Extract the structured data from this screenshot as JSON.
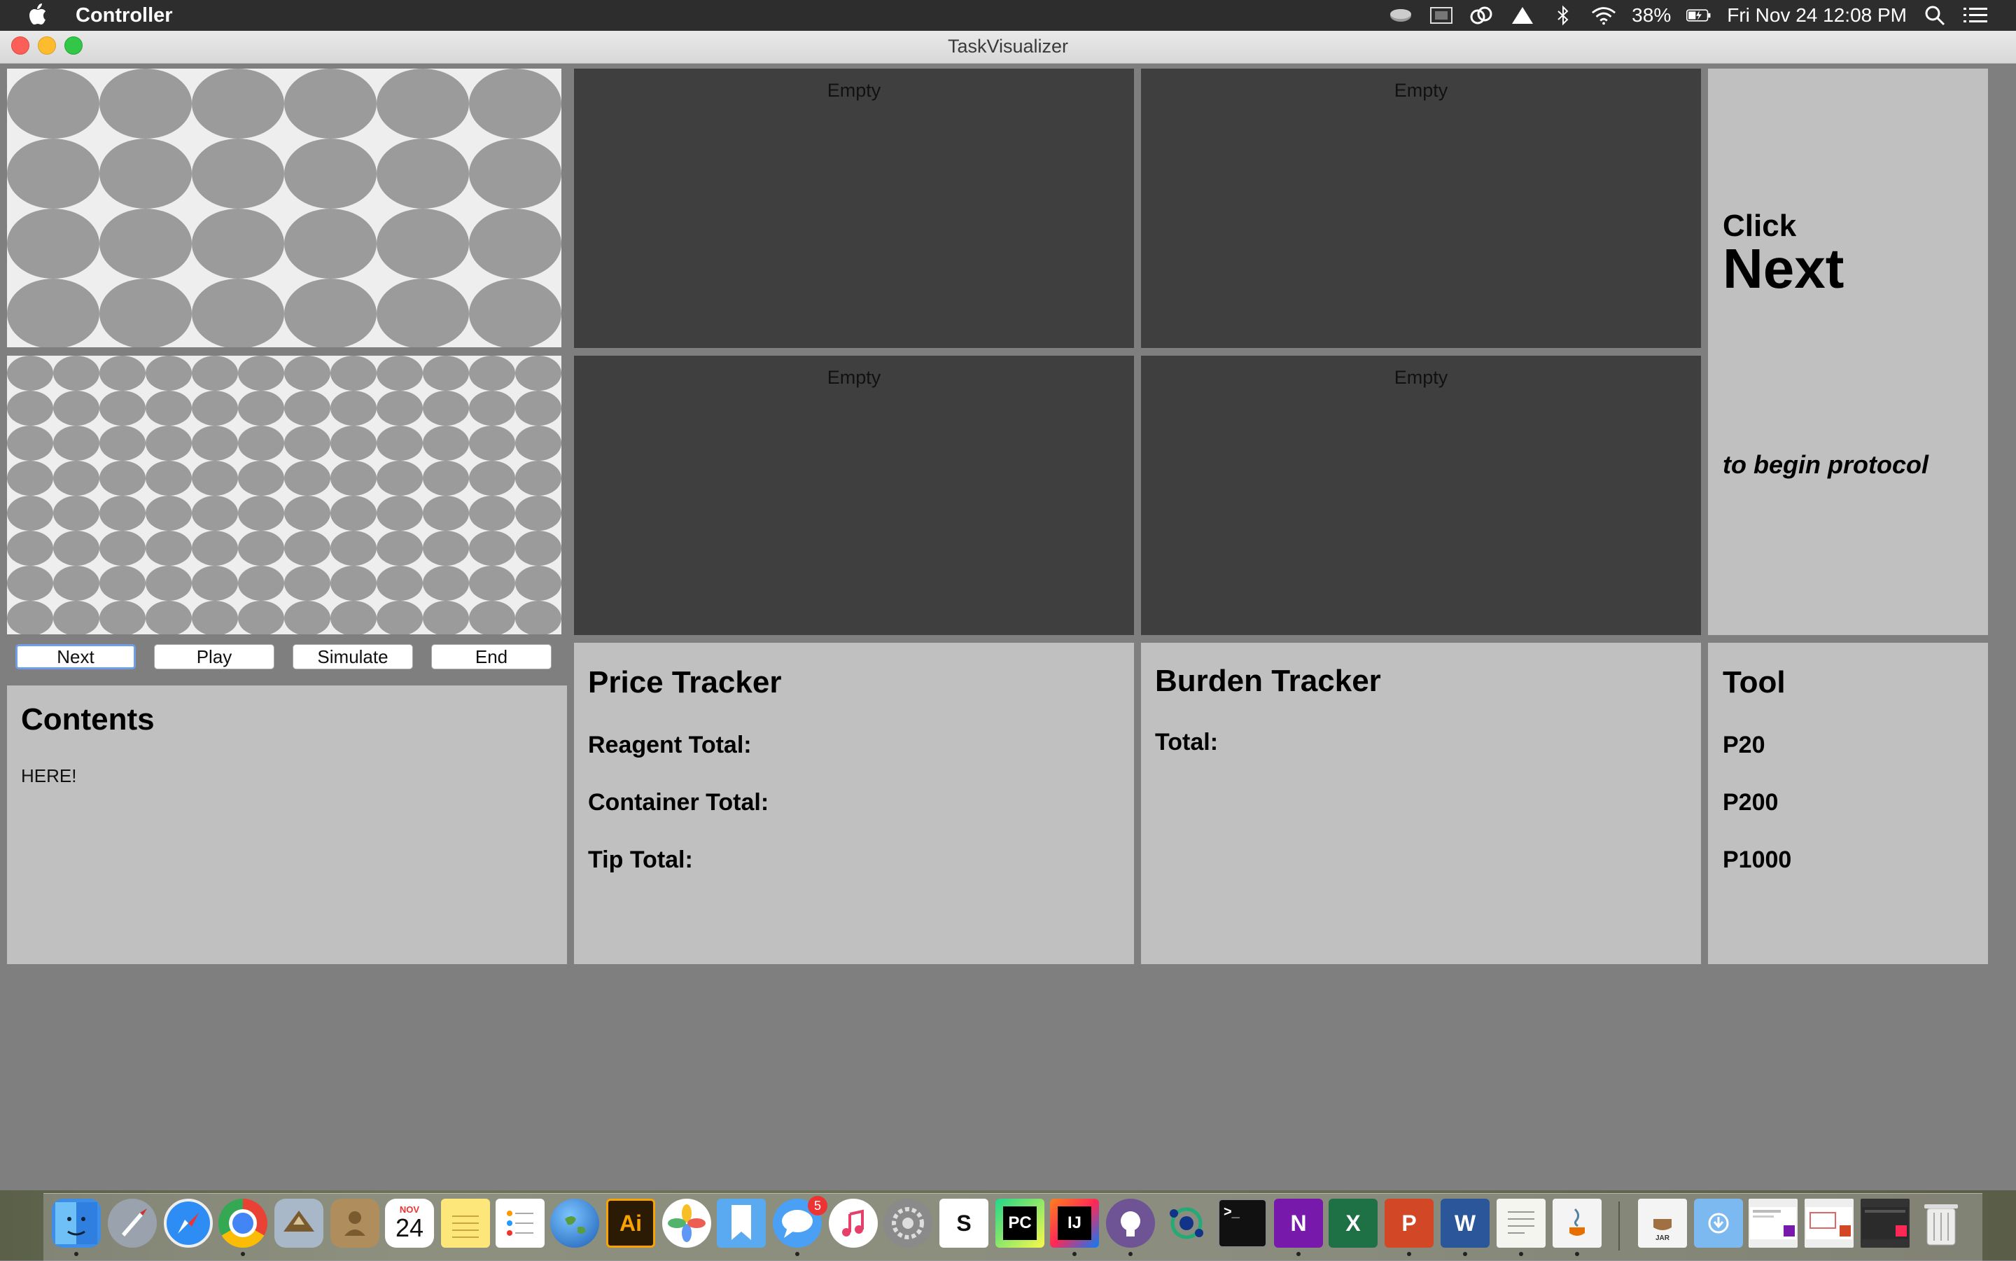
{
  "menubar": {
    "app_name": "Controller",
    "battery": "38%",
    "clock": "Fri Nov 24  12:08 PM"
  },
  "window": {
    "title": "TaskVisualizer"
  },
  "video_panels": {
    "p1": "Empty",
    "p2": "Empty",
    "p3": "Empty",
    "p4": "Empty"
  },
  "instruction": {
    "line1": "Click",
    "line2": "Next",
    "line3": "to begin protocol"
  },
  "controls": {
    "next": "Next",
    "play": "Play",
    "simulate": "Simulate",
    "end": "End"
  },
  "contents": {
    "title": "Contents",
    "body": "HERE!"
  },
  "price_tracker": {
    "title": "Price Tracker",
    "reagent": "Reagent Total:",
    "container": "Container Total:",
    "tip": "Tip Total:"
  },
  "burden_tracker": {
    "title": "Burden Tracker",
    "total": "Total:"
  },
  "tool": {
    "title": "Tool",
    "items": [
      "P20",
      "P200",
      "P1000"
    ]
  },
  "dock": {
    "calendar_month": "NOV",
    "calendar_day": "24",
    "messages_badge": "5",
    "icons": [
      "finder-icon",
      "launchpad-icon",
      "safari-icon",
      "chrome-icon",
      "mail-icon",
      "contacts-icon",
      "calendar-icon",
      "notes-icon",
      "reminders-icon",
      "globe-icon",
      "illustrator-icon",
      "photos-icon",
      "bookmarks-icon",
      "messages-icon",
      "itunes-icon",
      "system-preferences-icon",
      "scrivener-icon",
      "pycharm-icon",
      "intellij-icon",
      "github-icon",
      "network-icon",
      "terminal-icon",
      "onenote-icon",
      "excel-icon",
      "powerpoint-icon",
      "word-icon",
      "textedit-icon",
      "java-icon",
      "jar-file-icon",
      "downloads-folder-icon",
      "onenote-window-icon",
      "powerpoint-window-icon",
      "intellij-window-icon",
      "trash-icon"
    ]
  }
}
